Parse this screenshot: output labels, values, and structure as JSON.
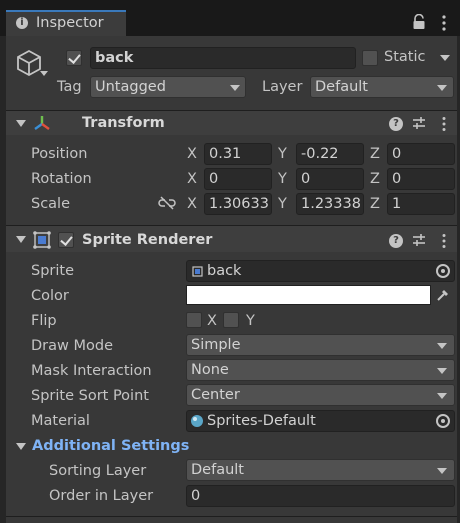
{
  "tab": {
    "title": "Inspector",
    "icon": "info-icon"
  },
  "header": {
    "object_active": true,
    "object_name": "back",
    "static_label": "Static",
    "static_checked": false,
    "tag_label": "Tag",
    "tag_value": "Untagged",
    "layer_label": "Layer",
    "layer_value": "Default"
  },
  "transform": {
    "title": "Transform",
    "rows": [
      {
        "label": "Position",
        "x": "0.31",
        "y": "-0.22",
        "z": "0"
      },
      {
        "label": "Rotation",
        "x": "0",
        "y": "0",
        "z": "0"
      },
      {
        "label": "Scale",
        "x": "1.30633",
        "y": "1.23338",
        "z": "1"
      }
    ],
    "axes": {
      "x": "X",
      "y": "Y",
      "z": "Z"
    }
  },
  "sprite_renderer": {
    "title": "Sprite Renderer",
    "enabled": true,
    "sprite_label": "Sprite",
    "sprite_value": "back",
    "color_label": "Color",
    "color_value": "#ffffff",
    "flip_label": "Flip",
    "flip_x": "X",
    "flip_y": "Y",
    "draw_mode_label": "Draw Mode",
    "draw_mode_value": "Simple",
    "mask_label": "Mask Interaction",
    "mask_value": "None",
    "sort_point_label": "Sprite Sort Point",
    "sort_point_value": "Center",
    "material_label": "Material",
    "material_value": "Sprites-Default",
    "additional_label": "Additional Settings",
    "sorting_layer_label": "Sorting Layer",
    "sorting_layer_value": "Default",
    "order_label": "Order in Layer",
    "order_value": "0"
  },
  "colors": {
    "accent": "#3a79bb",
    "link": "#7fb3f5",
    "panel": "#383838"
  }
}
